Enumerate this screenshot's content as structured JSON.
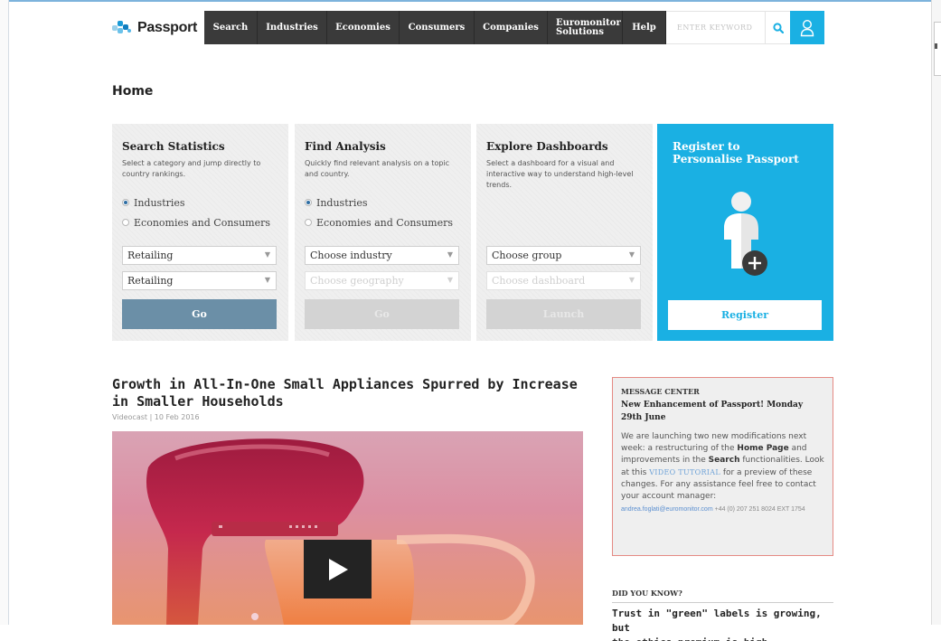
{
  "nav": {
    "logo_text": "Passport",
    "items": [
      {
        "label": "Search"
      },
      {
        "label": "Industries"
      },
      {
        "label": "Economies"
      },
      {
        "label": "Consumers"
      },
      {
        "label": "Companies"
      },
      {
        "label": "Euromonitor Solutions",
        "line1": "Euromonitor",
        "line2": "Solutions"
      },
      {
        "label": "Help"
      }
    ],
    "search_placeholder": "ENTER KEYWORD",
    "search_icon": "search-icon",
    "user_icon": "user-icon"
  },
  "page": {
    "title": "Home"
  },
  "panels": [
    {
      "title": "Search Statistics",
      "description": "Select a category and jump directly to country rankings.",
      "radios": [
        "Industries",
        "Economies and Consumers"
      ],
      "selected_radio": "Industries",
      "select1": "Retailing",
      "select2": "Retailing",
      "button": "Go"
    },
    {
      "title": "Find Analysis",
      "description": "Quickly find relevant analysis on a topic and country.",
      "radios": [
        "Industries",
        "Economies and Consumers"
      ],
      "selected_radio": "Industries",
      "select1": "Choose industry",
      "select2": "Choose geography",
      "button": "Go"
    },
    {
      "title": "Explore Dashboards",
      "description": "Select a dashboard for a visual and interactive way to understand high-level trends.",
      "select1": "Choose group",
      "select2": "Choose dashboard",
      "button": "Launch"
    }
  ],
  "register": {
    "title": "Register to Personalise Passport",
    "button": "Register",
    "icon": "user-add-icon"
  },
  "article": {
    "title": "Growth in All-In-One Small Appliances Spurred by Increase in Smaller Households",
    "meta": "Videocast | 10 Feb 2016",
    "play_icon": "play-icon"
  },
  "message_center": {
    "header": "MESSAGE CENTER",
    "subtitle": "New Enhancement of Passport! Monday 29th June",
    "body_1": "We are launching two new modifications next week: a restructuring of the ",
    "home_page": "Home Page",
    "body_2": " and improvements in the ",
    "search": "Search",
    "body_3": " functionalities. Look at this ",
    "video_link": "VIDEO TUTORIAL",
    "body_4": " for a preview of these changes. For any assistance feel free to contact your account manager:",
    "email": "andrea.foglati@euromonitor.com",
    "phone": " +44 (0) 207 251 8024 EXT 1754"
  },
  "did_you_know": {
    "header": "DID YOU KNOW?",
    "title_line1": "Trust in \"green\" labels is growing, but",
    "title_line2": "the ethics premium is high"
  },
  "colors": {
    "nav_bg": "#3a3a3a",
    "accent": "#1ab0e3",
    "go_button": "#6b8fa7",
    "message_border": "#e58a84"
  }
}
